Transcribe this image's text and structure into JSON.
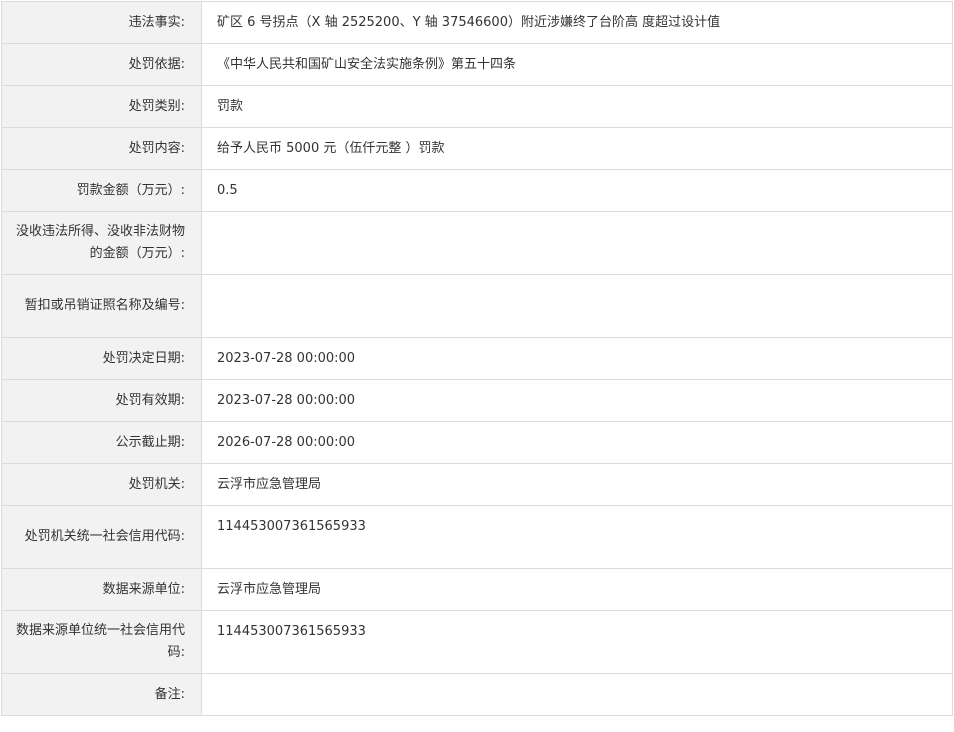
{
  "penalty_details": {
    "rows": [
      {
        "label": "违法事实:",
        "value": "矿区 6 号拐点（X 轴 2525200、Y 轴 37546600）附近涉嫌终了台阶高 度超过设计值"
      },
      {
        "label": "处罚依据:",
        "value": "《中华人民共和国矿山安全法实施条例》第五十四条"
      },
      {
        "label": "处罚类别:",
        "value": "罚款"
      },
      {
        "label": "处罚内容:",
        "value": "给予人民币 5000 元（伍仟元整 ）罚款"
      },
      {
        "label": "罚款金额（万元）:",
        "value": "0.5"
      },
      {
        "label": "没收违法所得、没收非法财物的金额（万元）:",
        "value": ""
      },
      {
        "label": "暂扣或吊销证照名称及编号:",
        "value": ""
      },
      {
        "label": "处罚决定日期:",
        "value": "2023-07-28 00:00:00"
      },
      {
        "label": "处罚有效期:",
        "value": "2023-07-28 00:00:00"
      },
      {
        "label": "公示截止期:",
        "value": "2026-07-28 00:00:00"
      },
      {
        "label": "处罚机关:",
        "value": "云浮市应急管理局"
      },
      {
        "label": "处罚机关统一社会信用代码:",
        "value": "114453007361565933"
      },
      {
        "label": "数据来源单位:",
        "value": "云浮市应急管理局"
      },
      {
        "label": "数据来源单位统一社会信用代码:",
        "value": "114453007361565933"
      },
      {
        "label": "备注:",
        "value": ""
      }
    ]
  }
}
